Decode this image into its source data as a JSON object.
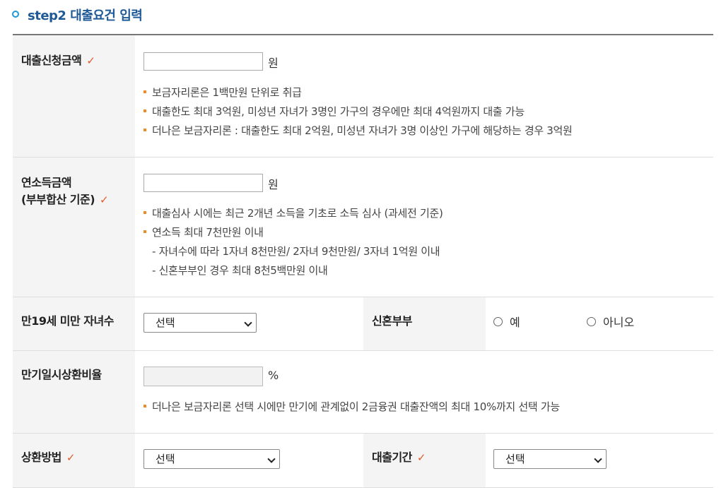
{
  "header": {
    "title": "step2 대출요건 입력"
  },
  "colors": {
    "accent": "#1f5a96",
    "bullet": "#f08a24",
    "required": "#e05a2b"
  },
  "icons": {
    "required": "check-icon",
    "title": "circle-bullet-icon",
    "select": "chevron-down-icon",
    "radio": "radio-empty-icon"
  },
  "loan_amount": {
    "label": "대출신청금액",
    "required_mark": "✓",
    "value": "",
    "unit": "원",
    "notes": [
      "보금자리론은 1백만원 단위로 취급",
      "대출한도 최대 3억원, 미성년 자녀가 3명인 가구의 경우에만 최대 4억원까지 대출 가능",
      "더나은 보금자리론 : 대출한도 최대 2억원, 미성년 자녀가 3명 이상인 가구에 해당하는 경우 3억원"
    ]
  },
  "income": {
    "label_line1": "연소득금액",
    "label_line2": "(부부합산 기준)",
    "required_mark": "✓",
    "value": "",
    "unit": "원",
    "notes": [
      "대출심사 시에는 최근 2개년 소득을 기초로 소득 심사 (과세전 기준)",
      "연소득 최대 7천만원 이내"
    ],
    "sub_notes": [
      "- 자녀수에 따라 1자녀 8천만원/ 2자녀 9천만원/ 3자녀 1억원 이내",
      "- 신혼부부인 경우 최대 8천5백만원 이내"
    ]
  },
  "children": {
    "label": "만19세 미만 자녀수",
    "selected": "선택"
  },
  "newlywed": {
    "label": "신혼부부",
    "options": [
      "예",
      "아니오"
    ]
  },
  "lump_sum_ratio": {
    "label": "만기일시상환비율",
    "value": "",
    "unit": "%",
    "notes": [
      "더나은 보금자리론 선택 시에만 만기에 관계없이 2금융권 대출잔액의 최대 10%까지 선택 가능"
    ]
  },
  "repayment_method": {
    "label": "상환방법",
    "required_mark": "✓",
    "selected": "선택"
  },
  "loan_period": {
    "label": "대출기간",
    "required_mark": "✓",
    "selected": "선택"
  }
}
